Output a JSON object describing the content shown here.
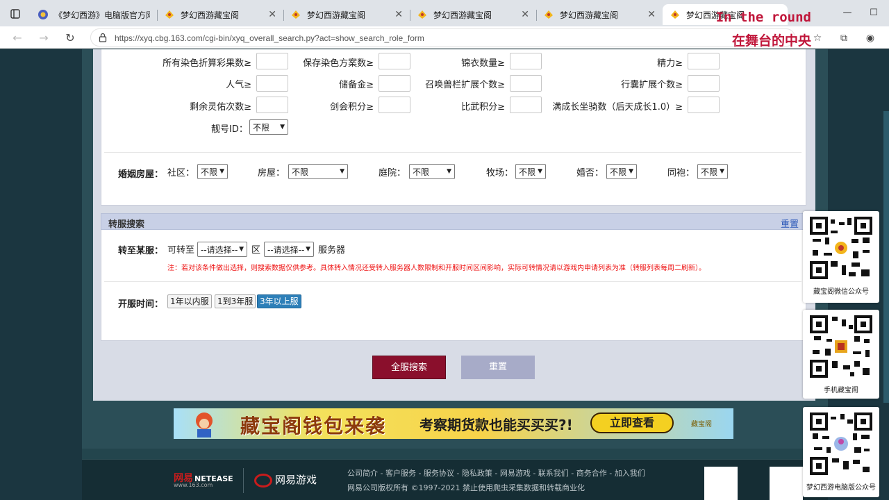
{
  "browser": {
    "tabs": [
      {
        "title": "《梦幻西游》电脑版官方网",
        "active": false
      },
      {
        "title": "梦幻西游藏宝阁",
        "active": false
      },
      {
        "title": "梦幻西游藏宝阁",
        "active": false
      },
      {
        "title": "梦幻西游藏宝阁",
        "active": false
      },
      {
        "title": "梦幻西游藏宝阁",
        "active": false
      },
      {
        "title": "梦幻西游藏宝阁",
        "active": true
      }
    ],
    "url": "https://xyq.cbg.163.com/cgi-bin/xyq_overall_search.py?act=show_search_role_form"
  },
  "overlay": {
    "line1": "In the round",
    "line2": "在舞台的中央"
  },
  "filters": {
    "row1": [
      "所有染色折算彩果数≥",
      "保存染色方案数≥",
      "锦衣数量≥",
      "精力≥"
    ],
    "row2": [
      "人气≥",
      "储备金≥",
      "召唤兽栏扩展个数≥",
      "行囊扩展个数≥"
    ],
    "row3": [
      "剩余灵佑次数≥",
      "剑会积分≥",
      "比武积分≥",
      "满成长坐骑数（后天成长1.0）≥"
    ],
    "pretty_id_label": "靓号ID：",
    "pretty_id_value": "不限"
  },
  "marriage": {
    "title": "婚姻房屋：",
    "fields": [
      {
        "label": "社区：",
        "value": "不限"
      },
      {
        "label": "房屋：",
        "value": "不限"
      },
      {
        "label": "庭院：",
        "value": "不限"
      },
      {
        "label": "牧场：",
        "value": "不限"
      },
      {
        "label": "婚否：",
        "value": "不限"
      },
      {
        "label": "同袍：",
        "value": "不限"
      }
    ]
  },
  "transfer": {
    "section_title": "转服搜索",
    "reset_link": "重置",
    "row_title": "转至某服：",
    "can_transfer": "可转至",
    "select1": "--请选择--",
    "zone": "区",
    "select2": "--请选择--",
    "server": "服务器",
    "note": "注：若对该条件做出选择，则搜索数据仅供参考。具体转入情况还受转入服务器人数限制和开服时间区间影响，实际可转情况请以游戏内申请列表为准（转服列表每周二刷新）。",
    "open_time_title": "开服时间：",
    "open_time_options": [
      {
        "label": "1年以内服",
        "selected": false
      },
      {
        "label": "1到3年服",
        "selected": false
      },
      {
        "label": "3年以上服",
        "selected": true
      }
    ]
  },
  "actions": {
    "search": "全服搜索",
    "reset": "重置"
  },
  "banner": {
    "headline": "藏宝阁钱包来袭",
    "subline": "考察期货款也能买买买?!",
    "cta": "立即查看",
    "logo": "藏宝阁"
  },
  "footer": {
    "logo_cn": "网易",
    "logo_en": "NETEASE",
    "logo_url": "www.163.com",
    "game_logo": "网易游戏",
    "links": "公司简介 - 客户服务 - 服务协议 - 隐私政策 - 网易游戏 - 联系我们 - 商务合作 - 加入我们",
    "copyright": "网易公司版权所有 ©1997-2021  禁止使用爬虫采集数据和转载商业化"
  },
  "qr_cards": [
    {
      "caption": "藏宝阁微信公众号"
    },
    {
      "caption": "手机藏宝阁"
    },
    {
      "caption": "梦幻西游电脑版公众号"
    }
  ],
  "colors": {
    "primary_button": "#8a0f2c",
    "secondary_button": "#a7abc8",
    "selected_chip": "#2d7fb8",
    "note_text": "#e11111",
    "overlay_text": "#c0163a"
  }
}
